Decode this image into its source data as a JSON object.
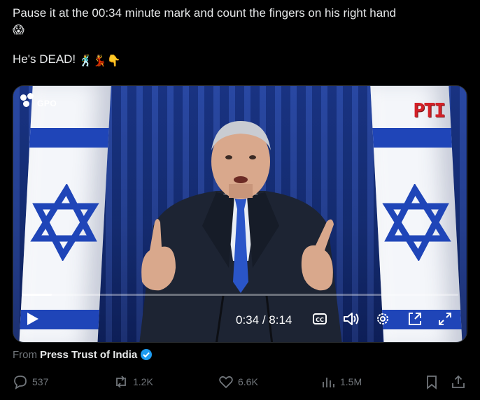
{
  "post": {
    "line1": "Pause it at the 00:34 minute mark and count the fingers on his right hand",
    "line1_emoji": "😱",
    "line2": "He's DEAD!",
    "line2_emojis": "🕺💃👇"
  },
  "video": {
    "logo_left": "GPO",
    "logo_right": "PTI",
    "current_time": "0:34",
    "separator": " / ",
    "duration": "8:14",
    "progress_fraction": 0.069
  },
  "source": {
    "prefix": "From",
    "name": "Press Trust of India"
  },
  "actions": {
    "replies": "537",
    "reposts": "1.2K",
    "likes": "6.6K",
    "views": "1.5M"
  },
  "colors": {
    "background": "#000000",
    "text": "#e7e9ea",
    "muted": "#71767b",
    "verified": "#1d9bf0",
    "flag_blue": "#1f45b8"
  }
}
